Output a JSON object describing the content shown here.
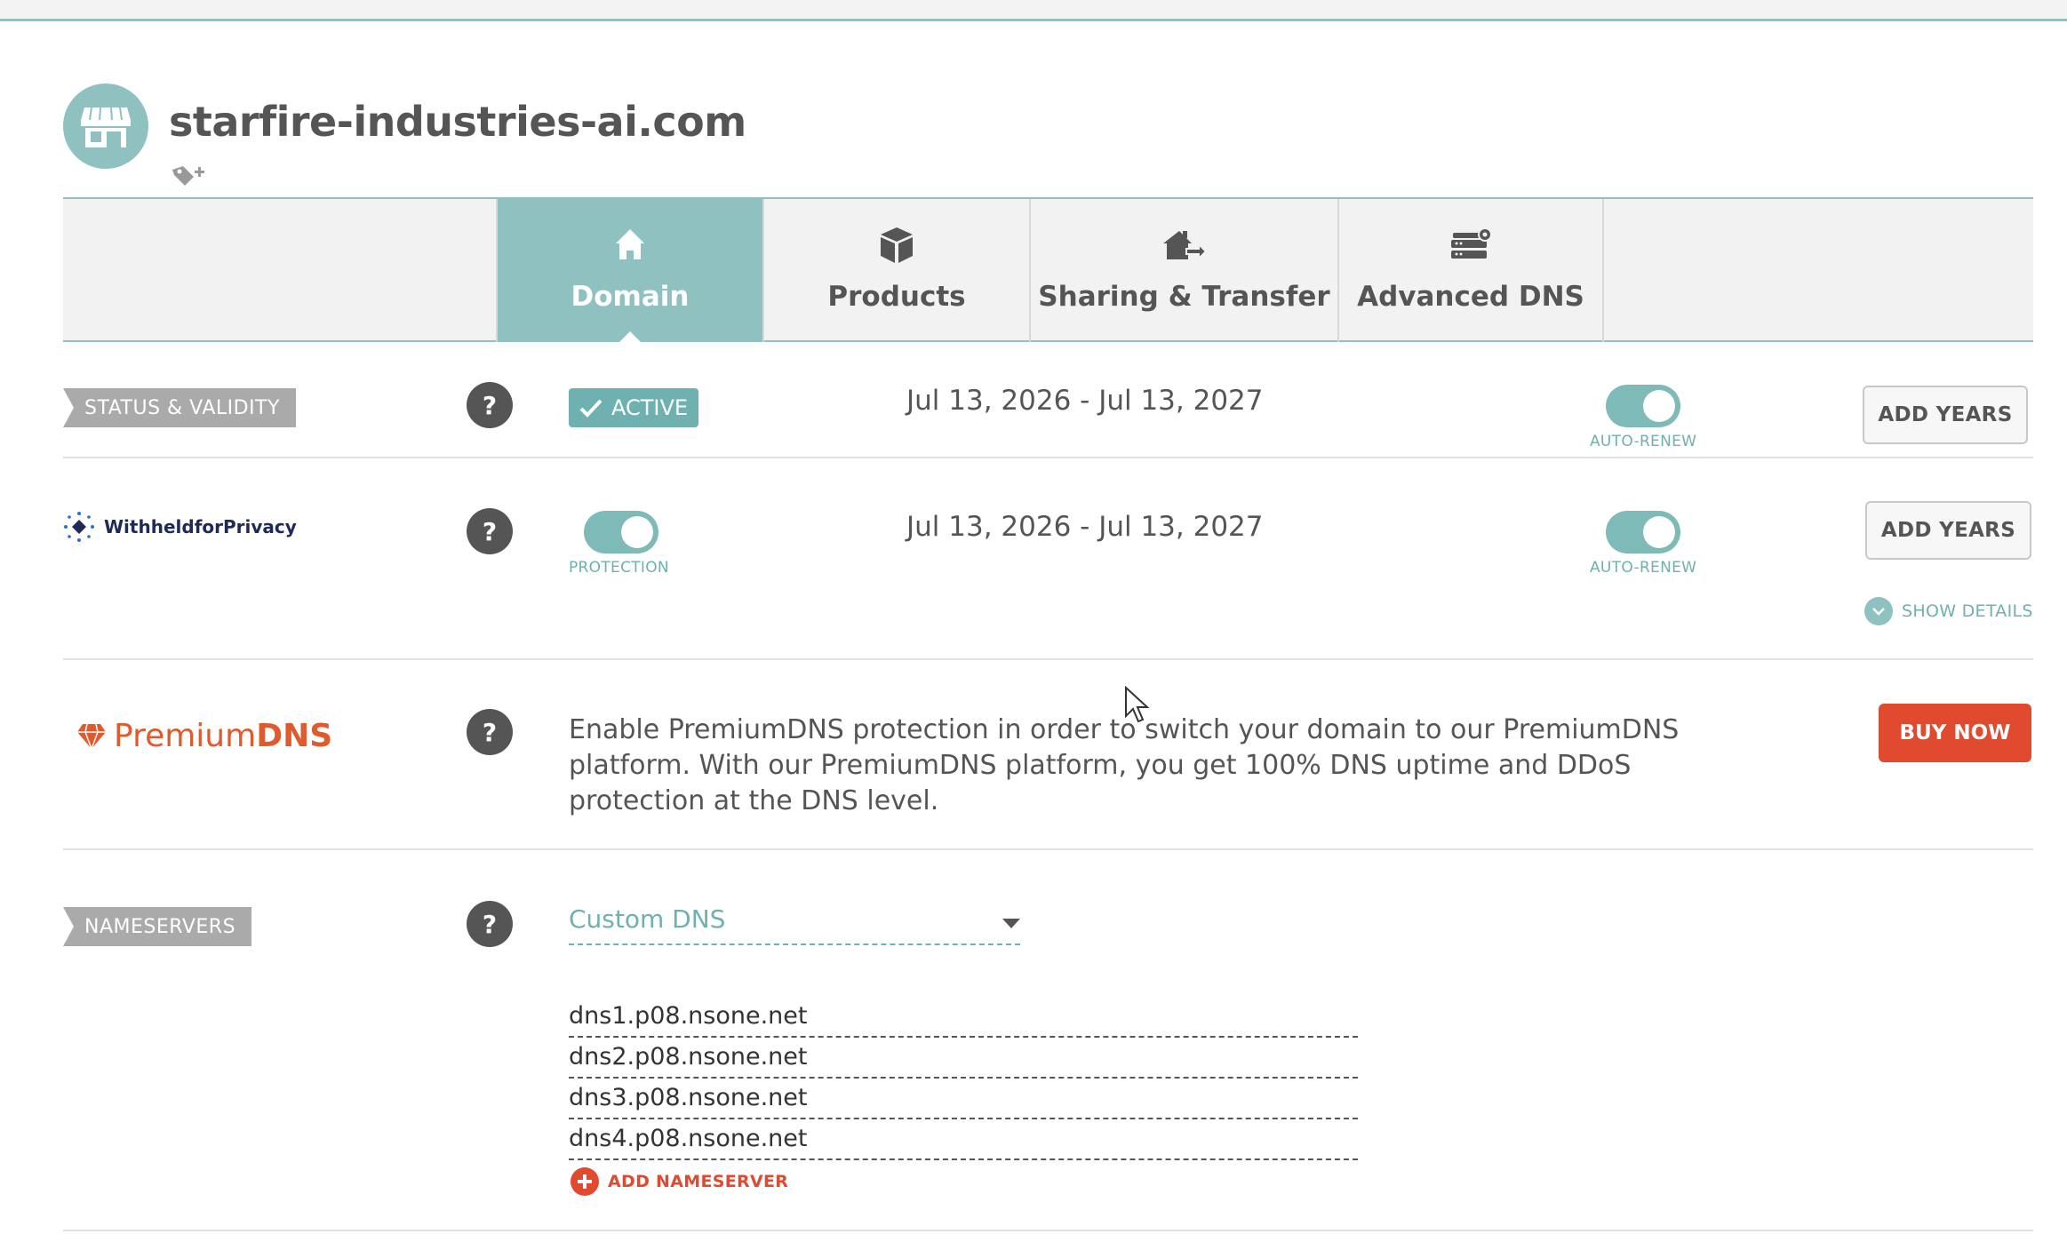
{
  "domain": {
    "name": "starfire-industries-ai.com"
  },
  "tabs": [
    {
      "label": "Domain",
      "icon": "home-icon",
      "active": true
    },
    {
      "label": "Products",
      "icon": "box-icon",
      "active": false
    },
    {
      "label": "Sharing & Transfer",
      "icon": "transfer-icon",
      "active": false
    },
    {
      "label": "Advanced DNS",
      "icon": "server-icon",
      "active": false
    }
  ],
  "status": {
    "section_label": "STATUS & VALIDITY",
    "badge": "ACTIVE",
    "date_range": "Jul 13, 2026 - Jul 13, 2027",
    "autorenew_label": "AUTO-RENEW",
    "autorenew_on": true,
    "add_years_label": "ADD YEARS"
  },
  "privacy": {
    "logo_text": "WithheldforPrivacy",
    "protection_label": "PROTECTION",
    "protection_on": true,
    "date_range": "Jul 13, 2026 - Jul 13, 2027",
    "autorenew_label": "AUTO-RENEW",
    "autorenew_on": true,
    "add_years_label": "ADD YEARS",
    "show_details_label": "SHOW DETAILS"
  },
  "premium_dns": {
    "logo_text_a": "Premium",
    "logo_text_b": "DNS",
    "description": "Enable PremiumDNS protection in order to switch your domain to our PremiumDNS platform. With our PremiumDNS platform, you get 100% DNS uptime and DDoS protection at the DNS level.",
    "buy_label": "BUY NOW"
  },
  "nameservers": {
    "section_label": "NAMESERVERS",
    "selected": "Custom DNS",
    "servers": [
      "dns1.p08.nsone.net",
      "dns2.p08.nsone.net",
      "dns3.p08.nsone.net",
      "dns4.p08.nsone.net"
    ],
    "add_label": "ADD NAMESERVER"
  },
  "help_label": "?",
  "colors": {
    "accent": "#8fc1c1",
    "toggle": "#7dbab8",
    "danger": "#e04a2f",
    "text": "#555555"
  }
}
